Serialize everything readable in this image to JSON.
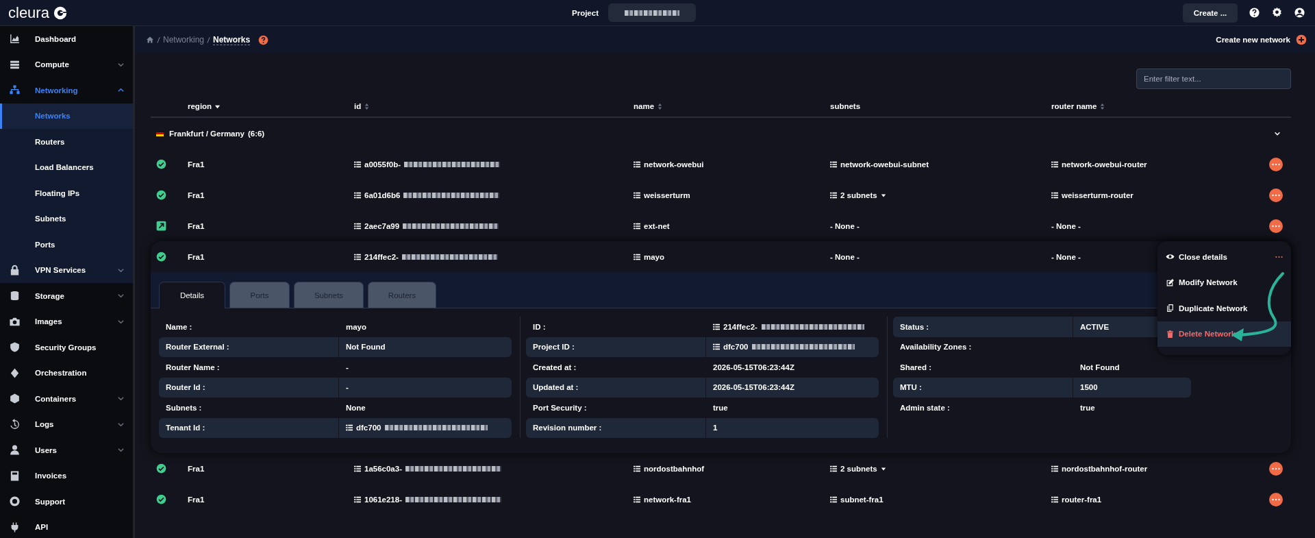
{
  "topbar": {
    "logo": "cleura",
    "project_label": "Project",
    "create_button": "Create ..."
  },
  "sidebar": {
    "items": [
      {
        "label": "Dashboard",
        "kind": "link",
        "selected": false
      },
      {
        "label": "Compute",
        "kind": "group",
        "expanded": false,
        "selected": false
      },
      {
        "label": "Networking",
        "kind": "group",
        "expanded": true,
        "selected": true,
        "children": [
          {
            "label": "Networks",
            "kind": "link",
            "selected": true
          },
          {
            "label": "Routers",
            "kind": "link",
            "selected": false
          },
          {
            "label": "Load Balancers",
            "kind": "link",
            "selected": false
          },
          {
            "label": "Floating IPs",
            "kind": "link",
            "selected": false
          },
          {
            "label": "Subnets",
            "kind": "link",
            "selected": false
          },
          {
            "label": "Ports",
            "kind": "link",
            "selected": false
          },
          {
            "label": "VPN Services",
            "kind": "group",
            "expanded": false,
            "selected": false
          }
        ]
      },
      {
        "label": "Storage",
        "kind": "group",
        "expanded": false,
        "selected": false
      },
      {
        "label": "Images",
        "kind": "group",
        "expanded": false,
        "selected": false
      },
      {
        "label": "Security Groups",
        "kind": "link",
        "selected": false
      },
      {
        "label": "Orchestration",
        "kind": "link",
        "selected": false
      },
      {
        "label": "Containers",
        "kind": "group",
        "expanded": false,
        "selected": false
      },
      {
        "label": "Logs",
        "kind": "group",
        "expanded": false,
        "selected": false
      },
      {
        "label": "Users",
        "kind": "group",
        "expanded": false,
        "selected": false
      },
      {
        "label": "Invoices",
        "kind": "link",
        "selected": false
      },
      {
        "label": "Support",
        "kind": "link",
        "selected": false
      },
      {
        "label": "API",
        "kind": "link",
        "selected": false
      }
    ]
  },
  "breadcrumb": [
    "Networking",
    "Networks"
  ],
  "create_link": "Create new network",
  "filter": {
    "placeholder": "Enter filter text..."
  },
  "table": {
    "columns": [
      {
        "label": "region",
        "sortable": true,
        "sorted": true
      },
      {
        "label": "id",
        "sortable": true,
        "sorted": false
      },
      {
        "label": "name",
        "sortable": true,
        "sorted": false
      },
      {
        "label": "subnets",
        "sortable": false,
        "sorted": false
      },
      {
        "label": "router name",
        "sortable": true,
        "sorted": false
      }
    ],
    "group": {
      "label": "Frankfurt / Germany",
      "count": "(6:6)",
      "expanded": true
    },
    "rows": [
      {
        "kind": "active",
        "region": "Fra1",
        "id": "a0055f0b-",
        "name": "network-owebui",
        "subnets": {
          "text": "network-owebui-subnet",
          "linked": true,
          "dropdown": false
        },
        "router": {
          "text": "network-owebui-router",
          "linked": true
        },
        "expanded": false
      },
      {
        "kind": "active",
        "region": "Fra1",
        "id": "6a01d6b6",
        "name": "weisserturm",
        "subnets": {
          "text": "2 subnets",
          "linked": true,
          "dropdown": true
        },
        "router": {
          "text": "weisserturm-router",
          "linked": true
        },
        "expanded": false
      },
      {
        "kind": "external",
        "region": "Fra1",
        "id": "2aec7a99",
        "name": "ext-net",
        "subnets": {
          "text": "- None -",
          "linked": false,
          "dropdown": false
        },
        "router": {
          "text": "- None -",
          "linked": false
        },
        "expanded": false
      },
      {
        "kind": "active",
        "region": "Fra1",
        "id": "214ffec2-",
        "name": "mayo",
        "subnets": {
          "text": "- None -",
          "linked": false,
          "dropdown": false
        },
        "router": {
          "text": "- None -",
          "linked": false
        },
        "expanded": true
      },
      {
        "kind": "active",
        "region": "Fra1",
        "id": "1a56c0a3-",
        "name": "nordostbahnhof",
        "subnets": {
          "text": "2 subnets",
          "linked": true,
          "dropdown": true
        },
        "router": {
          "text": "nordostbahnhof-router",
          "linked": true
        },
        "expanded": false
      },
      {
        "kind": "active",
        "region": "Fra1",
        "id": "1061e218-",
        "name": "network-fra1",
        "subnets": {
          "text": "subnet-fra1",
          "linked": true,
          "dropdown": false
        },
        "router": {
          "text": "router-fra1",
          "linked": true
        },
        "expanded": false
      }
    ]
  },
  "details": {
    "tabs": [
      {
        "label": "Details",
        "selected": true
      },
      {
        "label": "Ports",
        "selected": false
      },
      {
        "label": "Subnets",
        "selected": false
      },
      {
        "label": "Routers",
        "selected": false
      }
    ],
    "columns": [
      [
        {
          "label": "Name :",
          "value": "mayo",
          "shaded": false,
          "linked": false,
          "redacted": false
        },
        {
          "label": "Router External :",
          "value": "Not Found",
          "shaded": true,
          "linked": false,
          "redacted": false
        },
        {
          "label": "Router Name :",
          "value": "-",
          "shaded": false,
          "linked": false,
          "redacted": false
        },
        {
          "label": "Router Id :",
          "value": "-",
          "shaded": true,
          "linked": false,
          "redacted": false
        },
        {
          "label": "Subnets :",
          "value": "None",
          "shaded": false,
          "linked": false,
          "redacted": false
        },
        {
          "label": "Tenant Id :",
          "value": "dfc700",
          "shaded": true,
          "linked": true,
          "redacted": true
        }
      ],
      [
        {
          "label": "ID :",
          "value": "214ffec2-",
          "shaded": false,
          "linked": true,
          "redacted": true
        },
        {
          "label": "Project ID :",
          "value": "dfc700",
          "shaded": true,
          "linked": true,
          "redacted": true
        },
        {
          "label": "Created at :",
          "value": "2026-05-15T06:23:44Z",
          "shaded": false,
          "linked": false,
          "redacted": false
        },
        {
          "label": "Updated at :",
          "value": "2026-05-15T06:23:44Z",
          "shaded": true,
          "linked": false,
          "redacted": false
        },
        {
          "label": "Port Security :",
          "value": "true",
          "shaded": false,
          "linked": false,
          "redacted": false
        },
        {
          "label": "Revision number :",
          "value": "1",
          "shaded": true,
          "linked": false,
          "redacted": false
        }
      ],
      [
        {
          "label": "Status :",
          "value": "ACTIVE",
          "shaded": true,
          "linked": false,
          "redacted": false
        },
        {
          "label": "Availability Zones :",
          "shaded": false,
          "linked": false,
          "redacted": false
        },
        {
          "label": "Shared :",
          "value": "Not Found",
          "shaded": false,
          "linked": false,
          "redacted": false
        },
        {
          "label": "MTU :",
          "value": "1500",
          "shaded": true,
          "linked": false,
          "redacted": false
        },
        {
          "label": "Admin state :",
          "value": "true",
          "shaded": false,
          "linked": false,
          "redacted": false
        }
      ]
    ]
  },
  "menu": {
    "items": [
      {
        "label": "Close details",
        "kind": "close",
        "highlighted": false
      },
      {
        "label": "Modify Network",
        "kind": "normal",
        "highlighted": false
      },
      {
        "label": "Duplicate Network",
        "kind": "normal",
        "highlighted": false
      },
      {
        "label": "Delete Network",
        "kind": "danger",
        "highlighted": true
      }
    ]
  }
}
